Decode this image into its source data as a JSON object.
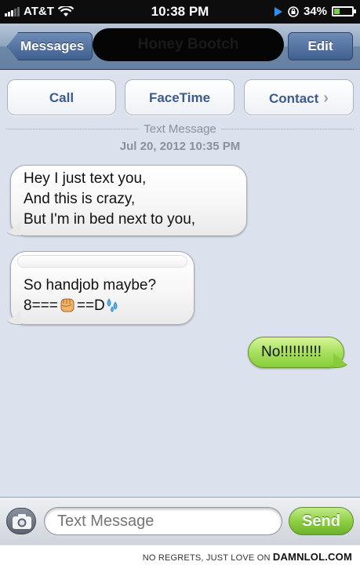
{
  "status_bar": {
    "carrier": "AT&T",
    "time": "10:38 PM",
    "battery": "34%",
    "battery_level": 0.34,
    "icons": [
      "signal-icon",
      "wifi-icon",
      "location-icon",
      "lock-rotation-icon",
      "battery-icon"
    ]
  },
  "nav": {
    "back_label": "Messages",
    "title_redacted": "Honey Bootch",
    "edit_label": "Edit"
  },
  "actions": {
    "call": "Call",
    "facetime": "FaceTime",
    "contact": "Contact"
  },
  "conversation": {
    "divider_label": "Text Message",
    "timestamp": "Jul 20, 2012 10:35 PM",
    "messages": [
      {
        "direction": "incoming",
        "lines": [
          "Hey I just text you,",
          "And this is crazy,",
          "But I'm in bed next to you,"
        ]
      },
      {
        "direction": "incoming",
        "lines": [
          "So handjob maybe?",
          "8===",
          "==D"
        ],
        "emoji": [
          "fist-icon",
          "sweat-drops-icon"
        ]
      },
      {
        "direction": "outgoing",
        "lines": [
          "No!!!!!!!!!!"
        ]
      }
    ]
  },
  "composer": {
    "placeholder": "Text Message",
    "send_label": "Send"
  },
  "footer": {
    "text": "NO REGRETS, JUST LOVE ON",
    "brand": "DAMNLOL.COM"
  },
  "colors": {
    "background": "#dbe2ed",
    "nav_blue": "#6680a2",
    "outgoing_green": "#a7e05d",
    "button_text": "#3d5b8d"
  }
}
